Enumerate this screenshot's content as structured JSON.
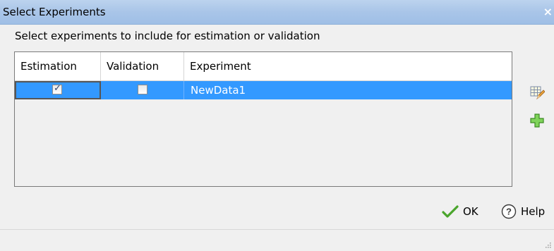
{
  "window": {
    "title": "Select Experiments",
    "close_label": "×"
  },
  "instruction": "Select experiments to include for estimation or validation",
  "table": {
    "columns": [
      "Estimation",
      "Validation",
      "Experiment"
    ],
    "rows": [
      {
        "estimation": true,
        "validation": false,
        "experiment": "NewData1",
        "selected": true
      }
    ]
  },
  "icons": {
    "edit": "edit-table-icon",
    "add": "add-icon",
    "ok": "checkmark-icon",
    "help": "help-icon"
  },
  "buttons": {
    "ok_label": "OK",
    "help_label": "Help"
  },
  "colors": {
    "selection": "#3399ff",
    "titlebar": "#a9c5e8",
    "add_green": "#5fbf3a",
    "ok_green": "#4aa52c"
  }
}
